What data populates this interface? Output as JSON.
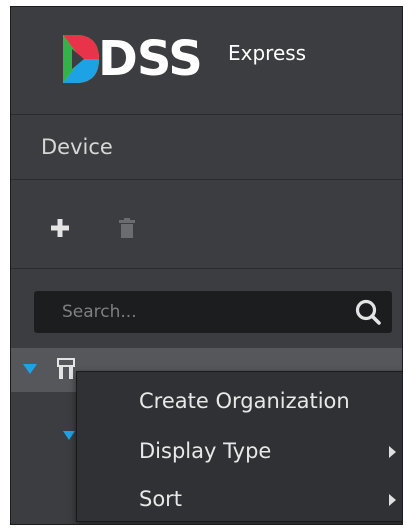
{
  "brand": {
    "name": "DSS",
    "edition": "Express"
  },
  "section": {
    "title": "Device"
  },
  "toolbar": {
    "add_icon": "plus-icon",
    "delete_icon": "trash-icon"
  },
  "search": {
    "placeholder": "Search...",
    "value": "",
    "icon": "search-icon"
  },
  "tree": {
    "expand_icon": "triangle-down-icon",
    "root_icon": "organization-icon"
  },
  "context_menu": {
    "items": [
      {
        "label": "Create Organization",
        "has_submenu": false
      },
      {
        "label": "Display Type",
        "has_submenu": true
      },
      {
        "label": "Sort",
        "has_submenu": true
      }
    ]
  },
  "colors": {
    "panel_bg": "#3b3d40",
    "menu_bg": "#303134",
    "accent": "#1ea2e6",
    "selected_row": "#55575a"
  }
}
